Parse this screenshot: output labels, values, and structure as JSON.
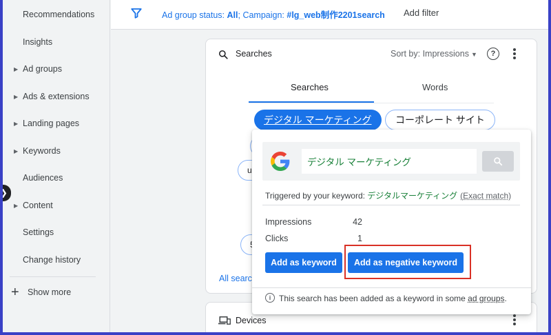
{
  "sidebar": {
    "items": [
      {
        "label": "Recommendations",
        "has_arrow": false
      },
      {
        "label": "Insights",
        "has_arrow": false
      },
      {
        "label": "Ad groups",
        "has_arrow": true
      },
      {
        "label": "Ads & extensions",
        "has_arrow": true
      },
      {
        "label": "Landing pages",
        "has_arrow": true
      },
      {
        "label": "Keywords",
        "has_arrow": true
      },
      {
        "label": "Audiences",
        "has_arrow": false
      },
      {
        "label": "Content",
        "has_arrow": true
      },
      {
        "label": "Settings",
        "has_arrow": false
      },
      {
        "label": "Change history",
        "has_arrow": false
      }
    ],
    "show_more": "Show more",
    "collapse_icon": "chevron-right-icon"
  },
  "filter_bar": {
    "prefix1": "Ad group status: ",
    "value1": "All",
    "prefix2": "; Campaign: ",
    "value2": "#lg_web制作2201search",
    "add_filter": "Add filter"
  },
  "searches_card": {
    "title": "Searches",
    "sort_by_label": "Sort by:",
    "sort_by_value": "Impressions",
    "tabs": [
      "Searches",
      "Words"
    ],
    "chips": [
      "デジタル マーケティング",
      "コーポレート サイト"
    ],
    "ghost_text": [
      "ui",
      "5"
    ],
    "all_searches": "All search"
  },
  "devices_card": {
    "title": "Devices"
  },
  "popup": {
    "query": "デジタル マーケティング",
    "triggered_prefix": "Triggered by your keyword: ",
    "triggered_keyword": "デジタルマーケティング",
    "match_type": "(Exact match)",
    "stats": [
      {
        "label": "Impressions",
        "value": "42"
      },
      {
        "label": "Clicks",
        "value": "1"
      }
    ],
    "add_keyword_button": "Add as keyword",
    "add_negative_button": "Add as negative keyword",
    "info_prefix": "This search has been added as a keyword in some ",
    "info_link": "ad groups",
    "info_suffix": "."
  },
  "colors": {
    "accent": "#1a73e8",
    "keyword_green": "#188038",
    "highlight_red": "#d93025",
    "frame_border": "#3a41c6"
  }
}
